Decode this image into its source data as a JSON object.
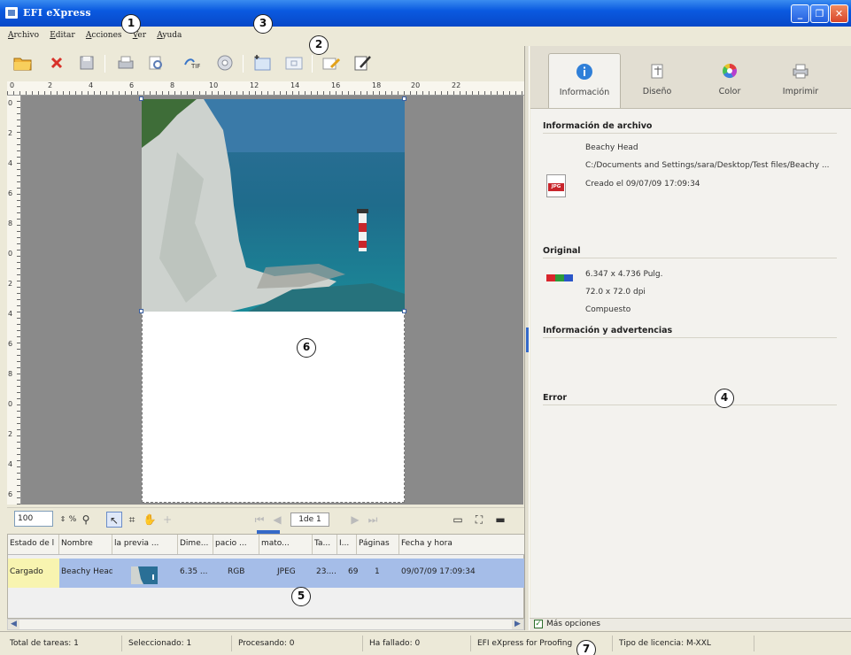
{
  "window": {
    "title": "EFI eXpress",
    "buttons": {
      "minimize": "_",
      "restore": "❐",
      "close": "✕"
    }
  },
  "menu": [
    "Archivo",
    "Editar",
    "Acciones",
    "Ver",
    "Ayuda"
  ],
  "toolbar_icons": [
    "open-folder-icon",
    "delete-icon",
    "save-icon",
    "print-icon",
    "preview-icon",
    "tiff-export-icon",
    "disc-icon",
    "new-page-icon",
    "page-frame-icon",
    "edit-icon",
    "edit-alt-icon"
  ],
  "ruler": {
    "h_labels": [
      "0",
      "2",
      "4",
      "6",
      "8",
      "10",
      "12",
      "14",
      "16",
      "18",
      "20",
      "22"
    ],
    "v_labels": [
      "0",
      "2",
      "4",
      "6",
      "8",
      "0",
      "2",
      "4",
      "6",
      "8",
      "0",
      "2",
      "4",
      "6"
    ]
  },
  "preview_toolbar": {
    "zoom": "100",
    "zoom_unit": "%",
    "page_indicator": "1de 1"
  },
  "grid": {
    "headers": [
      "Estado de l",
      "Nombre",
      "la previa ...",
      "Dime...",
      "pacio ...",
      "mato...",
      "Ta...",
      "I...",
      "Páginas",
      "Fecha y hora"
    ],
    "row": {
      "status": "Cargado",
      "name": "Beachy Head",
      "dimensions": "6.35 ...",
      "colorspace": "RGB",
      "format": "JPEG",
      "size": "23....",
      "resolution": "69",
      "pages": "1",
      "datetime": "09/07/09 17:09:34"
    }
  },
  "right_panel": {
    "tabs": [
      {
        "label": "Información",
        "icon": "info-icon"
      },
      {
        "label": "Diseño",
        "icon": "layout-icon"
      },
      {
        "label": "Color",
        "icon": "color-wheel-icon"
      },
      {
        "label": "Imprimir",
        "icon": "printer-icon"
      }
    ],
    "file_info": {
      "title": "Información de archivo",
      "name": "Beachy Head",
      "path": "C:/Documents and Settings/sara/Desktop/Test files/Beachy ...",
      "created": "Creado el 09/07/09 17:09:34",
      "icon_label": "JPG"
    },
    "original": {
      "title": "Original",
      "size": "6.347 x 4.736 Pulg.",
      "dpi": "72.0 x 72.0 dpi",
      "mode": "Compuesto"
    },
    "warnings_title": "Información y advertencias",
    "error_title": "Error",
    "more_options": "Más opciones"
  },
  "statusbar": {
    "total": "Total de tareas: 1",
    "selected": "Seleccionado: 1",
    "processing": "Procesando: 0",
    "failed": "Ha fallado: 0",
    "product": "EFI eXpress for Proofing",
    "license": "Tipo de licencia: M-XXL"
  },
  "callouts": [
    "1",
    "2",
    "3",
    "4",
    "5",
    "6",
    "7"
  ]
}
